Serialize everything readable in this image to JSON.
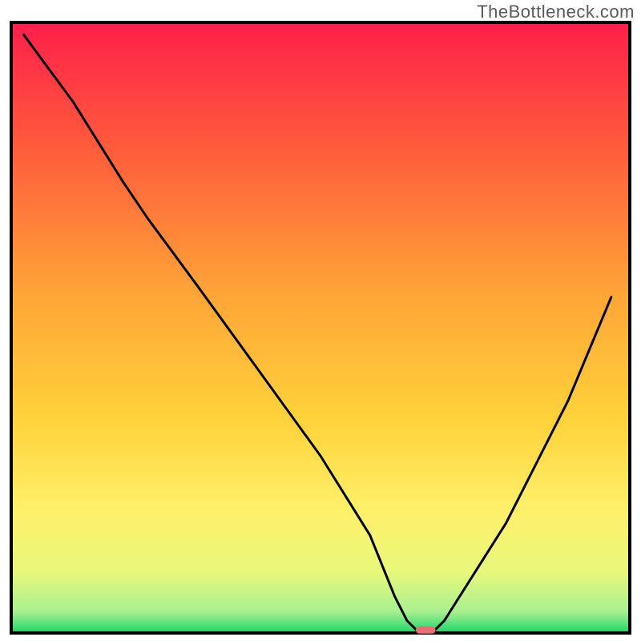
{
  "watermark": "TheBottleneck.com",
  "chart_data": {
    "type": "line",
    "title": "",
    "xlabel": "",
    "ylabel": "",
    "xlim": [
      0,
      100
    ],
    "ylim": [
      0,
      100
    ],
    "x": [
      2,
      10,
      18,
      22,
      30,
      40,
      50,
      58,
      62,
      64,
      66,
      68,
      70,
      80,
      90,
      97
    ],
    "values": [
      98,
      87,
      74,
      68,
      57,
      43,
      29,
      16,
      6,
      2,
      0,
      0,
      2,
      18,
      38,
      55
    ],
    "marker": {
      "x": 67,
      "y": 0.5,
      "w": 3.2,
      "h": 1.2,
      "color": "#e86f72"
    },
    "gradient_stops": [
      {
        "offset": 0.0,
        "color": "#ff1f4b"
      },
      {
        "offset": 0.2,
        "color": "#ff5a3c"
      },
      {
        "offset": 0.45,
        "color": "#ffa637"
      },
      {
        "offset": 0.65,
        "color": "#ffd23a"
      },
      {
        "offset": 0.8,
        "color": "#fff06a"
      },
      {
        "offset": 0.9,
        "color": "#e8f87a"
      },
      {
        "offset": 0.965,
        "color": "#a8f090"
      },
      {
        "offset": 1.0,
        "color": "#18d66b"
      }
    ],
    "outline_color": "#000000",
    "line_color": "#000000",
    "line_width": 3
  }
}
